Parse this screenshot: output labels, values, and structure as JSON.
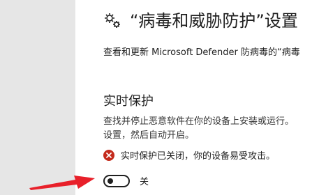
{
  "header": {
    "icon": "gears-icon",
    "title": "“病毒和威胁防护”设置"
  },
  "description": "查看和更新 Microsoft Defender 防病毒的“病毒",
  "realtime": {
    "title": "实时保护",
    "desc_line1": "查找并停止恶意软件在你的设备上安装或运行。",
    "desc_line2": "设置，然后自动开启。",
    "status_icon": "error-circle-icon",
    "status_text": "实时保护已关闭，你的设备易受攻击。",
    "toggle_state": "off",
    "toggle_label": "关"
  },
  "colors": {
    "rail": "#e6e6e6",
    "error": "#c42b1c",
    "arrow": "#e8202a"
  }
}
